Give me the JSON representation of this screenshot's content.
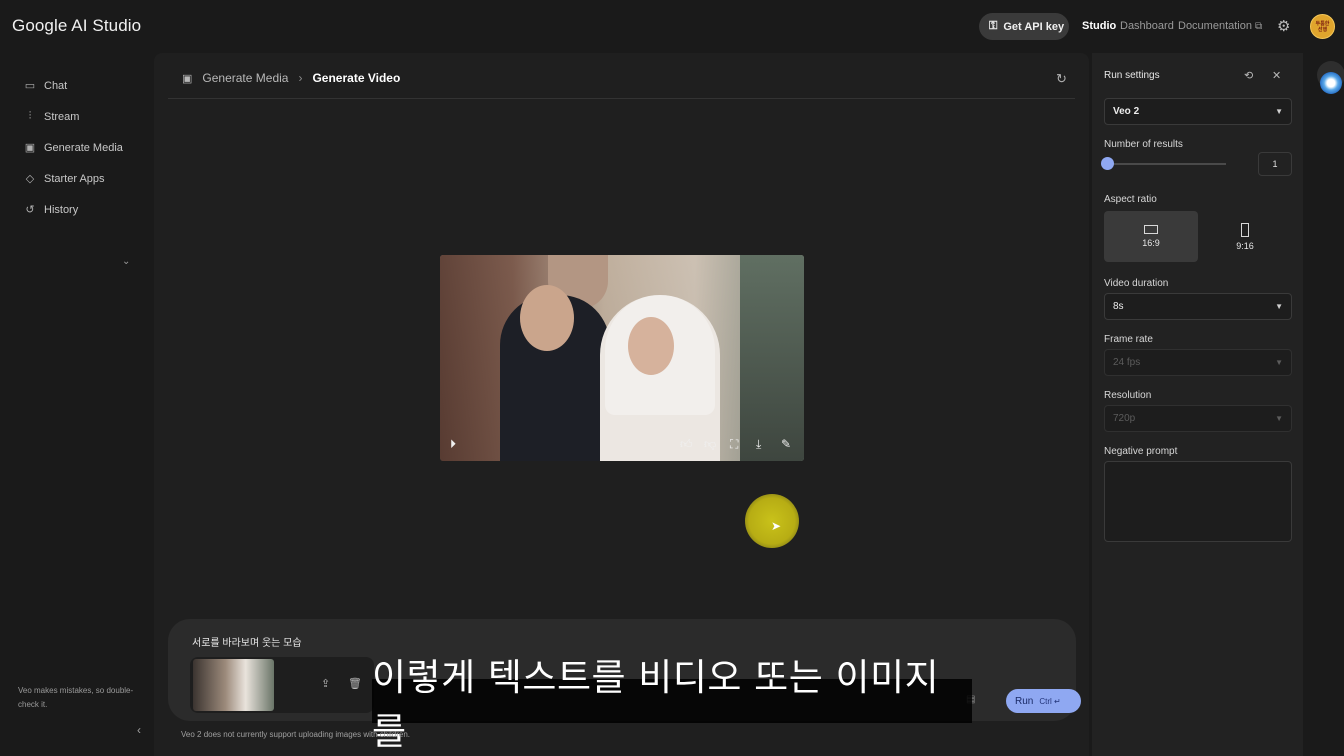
{
  "app": {
    "title": "Google AI Studio"
  },
  "header": {
    "api_key_label": "Get API key",
    "nav": {
      "studio": "Studio",
      "dashboard": "Dashboard",
      "documentation": "Documentation"
    },
    "avatar_text": "두툼한 선행"
  },
  "sidebar": {
    "items": [
      {
        "label": "Chat",
        "icon": "chat-icon"
      },
      {
        "label": "Stream",
        "icon": "stream-icon"
      },
      {
        "label": "Generate Media",
        "icon": "media-icon"
      },
      {
        "label": "Starter Apps",
        "icon": "apps-icon"
      },
      {
        "label": "History",
        "icon": "history-icon"
      }
    ],
    "note": "Veo makes mistakes, so double-check it."
  },
  "main": {
    "breadcrumb": {
      "parent": "Generate Media",
      "current": "Generate Video"
    },
    "prompt_text": "서로를 바라보며 웃는 모습",
    "run_label": "Run",
    "run_shortcut": "Ctrl ↵",
    "subtitle": "이렇게 텍스트를 비디오 또는 이미지를",
    "footnote": "Veo 2 does not currently support uploading images with children."
  },
  "run_settings": {
    "title": "Run settings",
    "model": "Veo 2",
    "number_of_results_label": "Number of results",
    "number_of_results": "1",
    "aspect_ratio_label": "Aspect ratio",
    "aspect_options": [
      "16:9",
      "9:16"
    ],
    "selected_aspect": "16:9",
    "video_duration_label": "Video duration",
    "video_duration": "8s",
    "frame_rate_label": "Frame rate",
    "frame_rate": "24 fps",
    "resolution_label": "Resolution",
    "resolution": "720p",
    "negative_prompt_label": "Negative prompt",
    "negative_prompt": ""
  },
  "colors": {
    "accent": "#8fa8f2",
    "background": "#1a1a1a",
    "panel": "#222222"
  }
}
